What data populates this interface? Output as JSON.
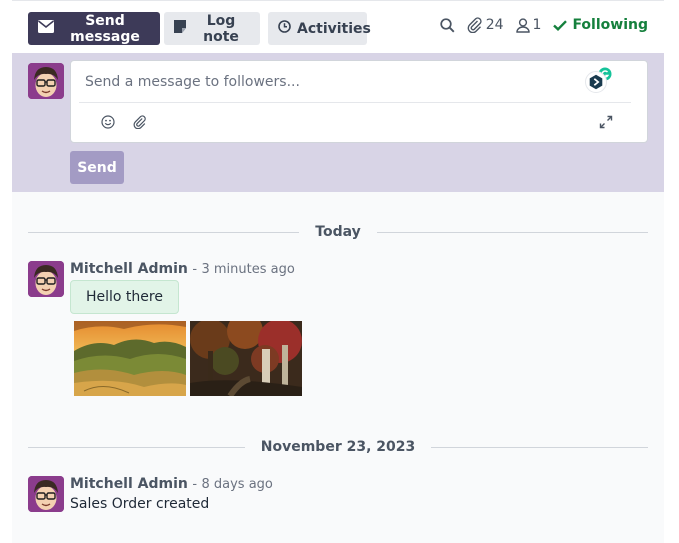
{
  "toolbar": {
    "send_message": "Send message",
    "log_note": "Log note",
    "activities": "Activities",
    "attachment_count": "24",
    "follower_count": "1",
    "following": "Following"
  },
  "composer": {
    "placeholder": "Send a message to followers...",
    "send_label": "Send"
  },
  "thread": {
    "separators": [
      "Today",
      "November 23, 2023"
    ],
    "messages": [
      {
        "author": "Mitchell Admin",
        "dash": "-",
        "time_ago": "3 minutes ago",
        "body": "Hello there",
        "attachments": [
          "mountain-landscape-image",
          "autumn-forest-image"
        ]
      },
      {
        "author": "Mitchell Admin",
        "dash": "-",
        "time_ago": "8 days ago",
        "body": "Sales Order created"
      }
    ]
  },
  "colors": {
    "primary": "#3d3a58",
    "composer_bg": "#d8d4e6",
    "send_disabled": "#a39bc4",
    "following": "#15803d",
    "bubble": "#e2f4e8"
  },
  "icons": [
    "envelope-icon",
    "note-icon",
    "clock-icon",
    "search-icon",
    "paperclip-icon",
    "user-icon",
    "check-icon",
    "emoji-icon",
    "attach-icon",
    "expand-icon",
    "grammarly-icon"
  ]
}
